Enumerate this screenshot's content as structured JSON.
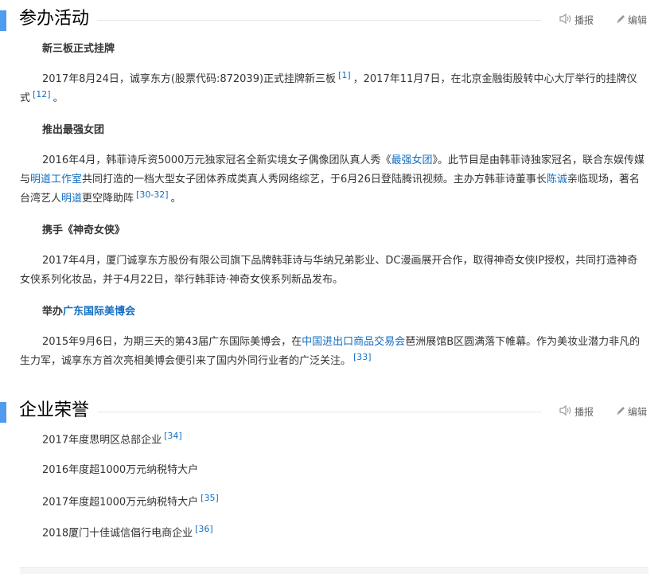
{
  "sections": [
    {
      "title": "参办活动",
      "actions": {
        "play": "播报",
        "edit": "编辑"
      }
    },
    {
      "title": "企业荣誉",
      "actions": {
        "play": "播报",
        "edit": "编辑"
      }
    }
  ],
  "activities": {
    "s1": {
      "heading": "新三板正式挂牌",
      "p": {
        "t1": "2017年8月24日，诚享东方(股票代码:872039)正式挂牌新三板",
        "r1": "[1]",
        "t2": "，2017年11月7日，在北京金融街股转中心大厅举行的挂牌仪式",
        "r2": "[12]",
        "t3": "。"
      }
    },
    "s2": {
      "heading": "推出最强女团",
      "p": {
        "t1": "2016年4月，韩菲诗斥资5000万元独家冠名全新实境女子偶像团队真人秀《",
        "l1": "最强女团",
        "t2": "》。此节目是由韩菲诗独家冠名，联合东娱传媒与",
        "l2": "明道工作室",
        "t3": "共同打造的一档大型女子团体养成类真人秀网络综艺，于6月26日登陆腾讯视频。主办方韩菲诗董事长",
        "l3": "陈诚",
        "t4": "亲临现场，著名台湾艺人",
        "l4": "明道",
        "t5": "更空降助阵",
        "r1": "[30-32]",
        "t6": "。"
      }
    },
    "s3": {
      "heading": "携手《神奇女侠》",
      "p": {
        "t1": "2017年4月，厦门诚享东方股份有限公司旗下品牌韩菲诗与华纳兄弟影业、DC漫画展开合作，取得神奇女侠IP授权，共同打造神奇女侠系列化妆品，并于4月22日，举行韩菲诗·神奇女侠系列新品发布。"
      }
    },
    "s4": {
      "heading_prefix": "举办",
      "heading_link": "广东国际美博会",
      "p": {
        "t1": "2015年9月6日，为期三天的第43届广东国际美博会，在",
        "l1": "中国进出口商品交易会",
        "t2": "琶洲展馆B区圆满落下帷幕。作为美妆业潜力非凡的生力军，诚享东方首次亮相美博会便引来了国内外同行业者的广泛关注。",
        "r1": "[33]"
      }
    }
  },
  "honors": [
    {
      "text": "2017年度思明区总部企业",
      "ref": "[34]"
    },
    {
      "text": "2016年度超1000万元纳税特大户",
      "ref": ""
    },
    {
      "text": "2017年度超1000万元纳税特大户",
      "ref": "[35]"
    },
    {
      "text": "2018厦门十佳诚信倡行电商企业",
      "ref": "[36]"
    }
  ],
  "icons": {
    "play": "speaker-icon",
    "edit": "pencil-icon"
  },
  "colors": {
    "accent_bar": "#4f9cee",
    "link": "#136ec2"
  }
}
